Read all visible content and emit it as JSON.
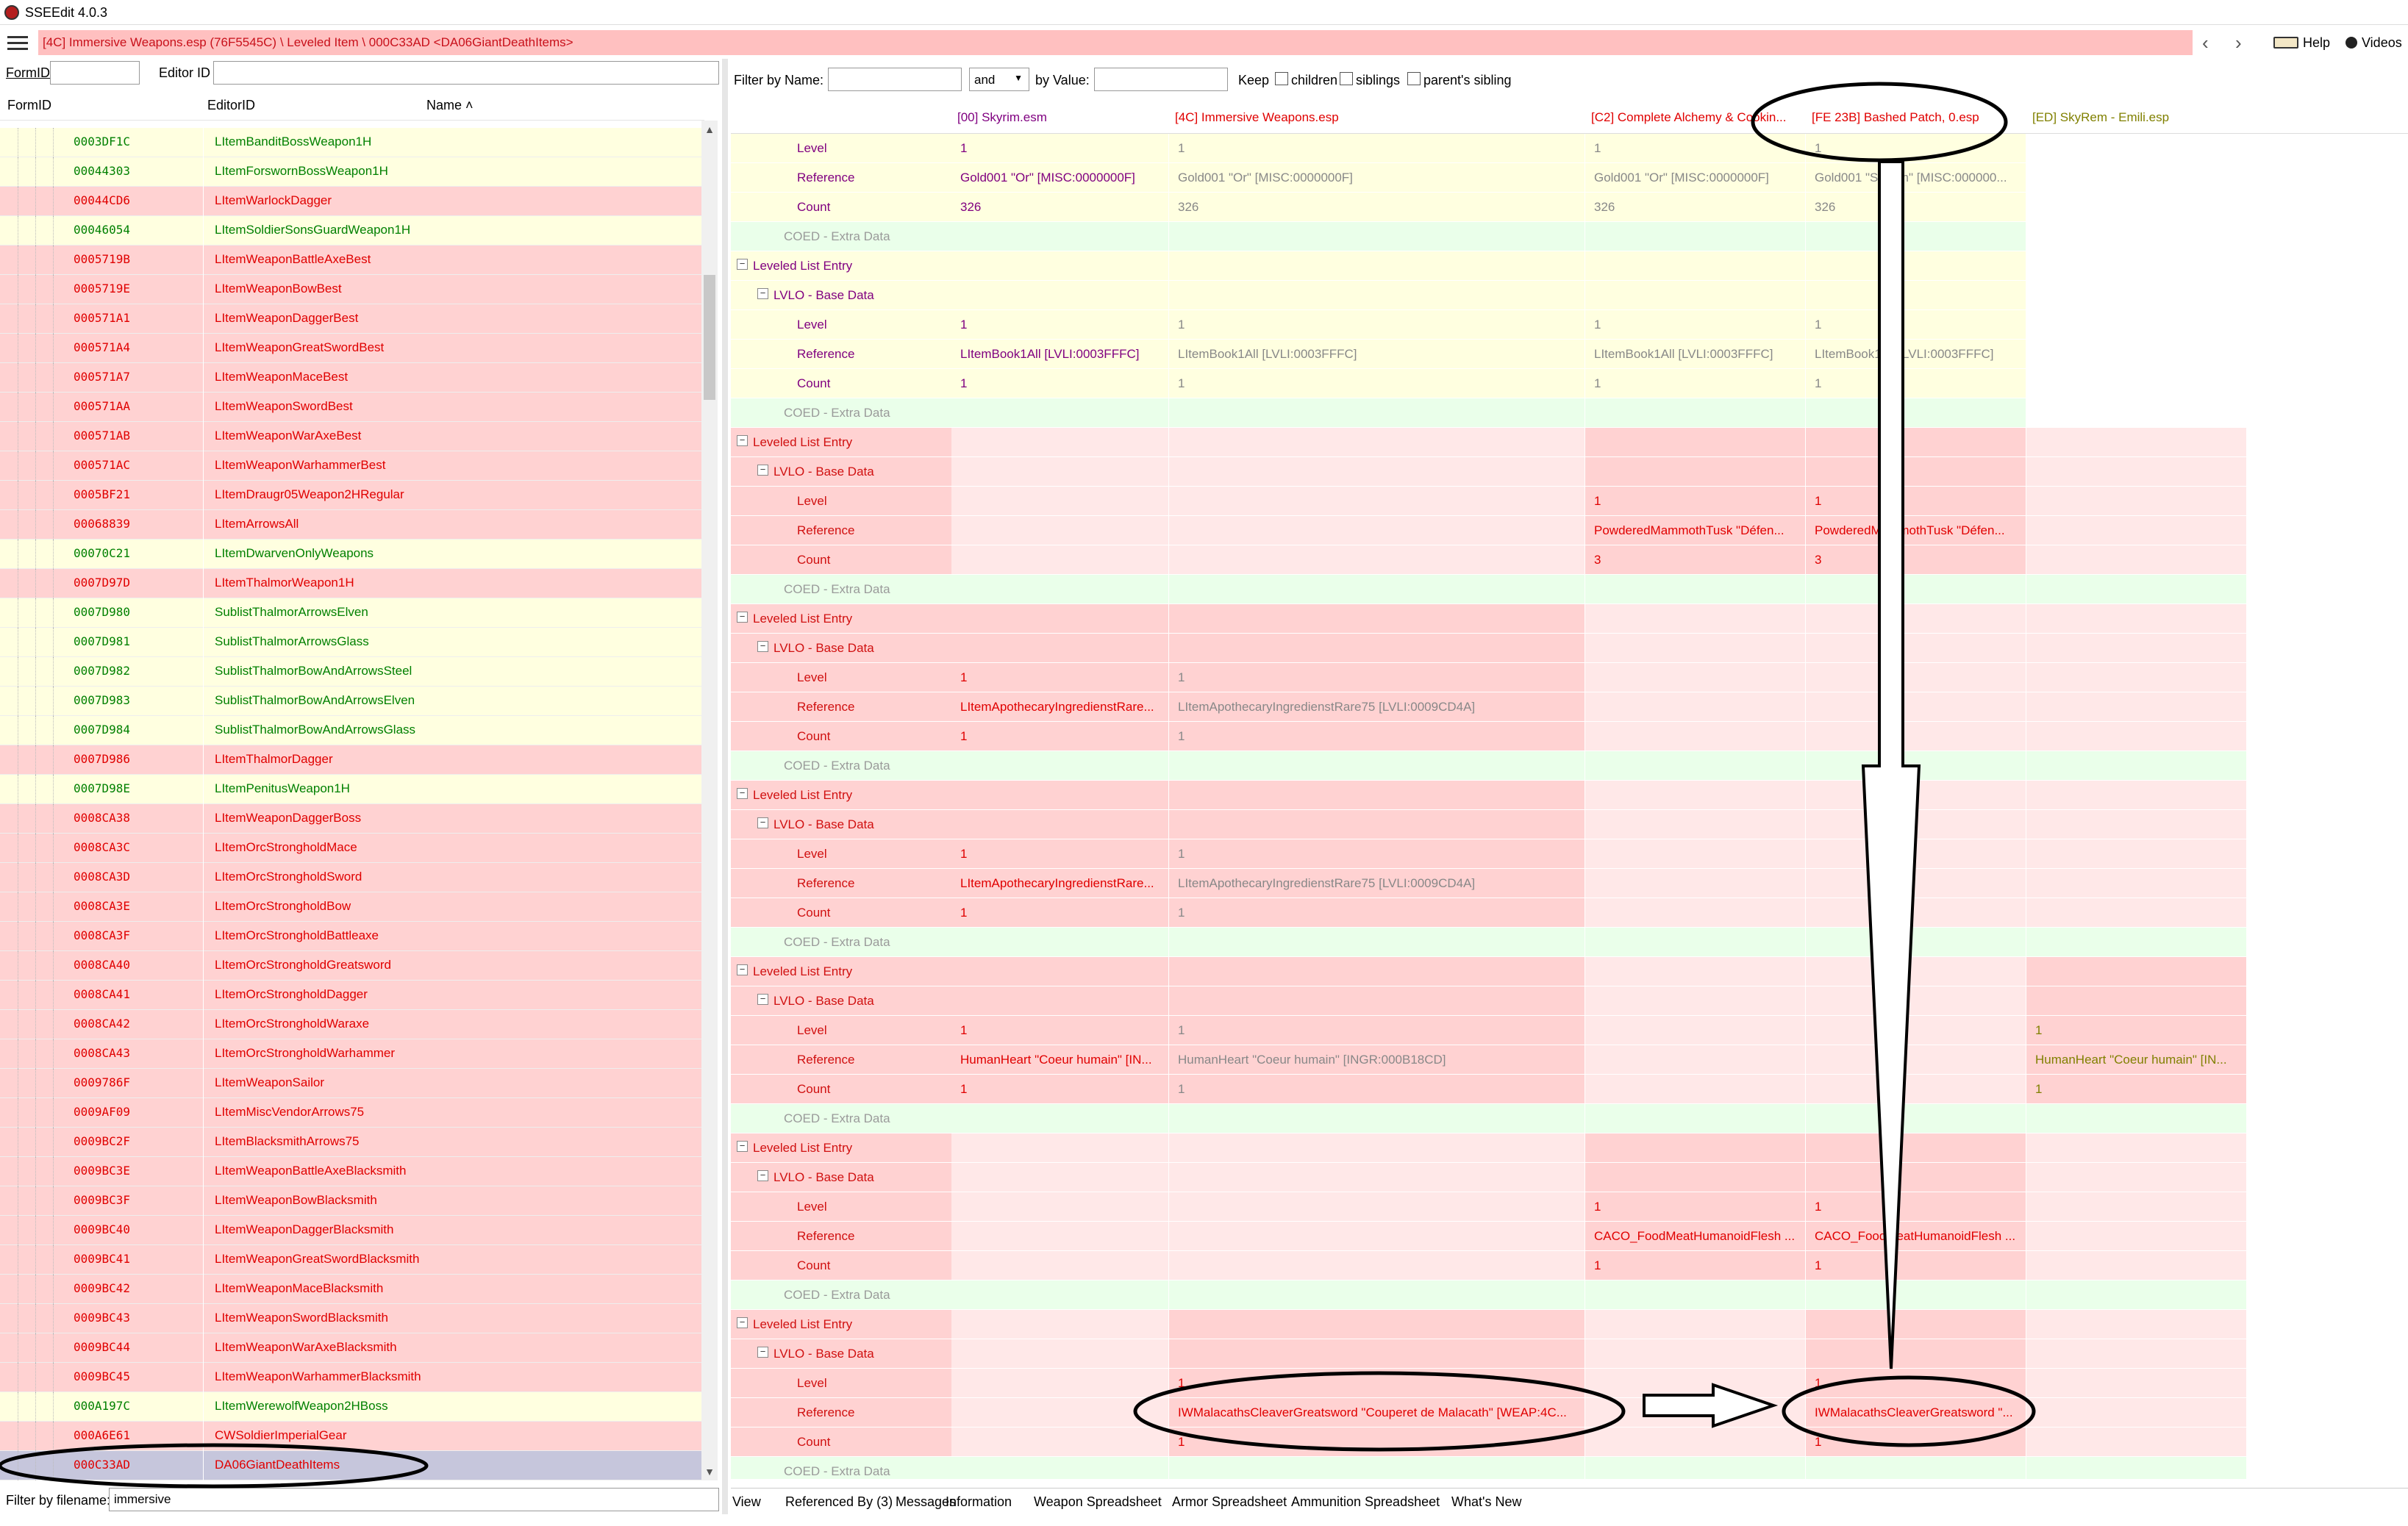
{
  "app": {
    "title": "SSEEdit 4.0.3"
  },
  "path": "[4C] Immersive Weapons.esp (76F5545C) \\ Leveled Item \\ 000C33AD <DA06GiantDeathItems>",
  "nav": {
    "back": "‹",
    "forward": "›",
    "help": "Help",
    "videos": "Videos"
  },
  "left_filter": {
    "formid_label": "FormID",
    "editorid_label": "Editor ID",
    "formid_value": "",
    "editorid_value": ""
  },
  "left_columns": {
    "formid": "FormID",
    "editorid": "EditorID",
    "name": "Name ˄"
  },
  "left_rows": [
    {
      "formid": "0003DF1C",
      "editorid": "LItemBanditBossWeapon1H",
      "status": "ok"
    },
    {
      "formid": "00044303",
      "editorid": "LItemForswornBossWeapon1H",
      "status": "ok"
    },
    {
      "formid": "00044CD6",
      "editorid": "LItemWarlockDagger",
      "status": "conflict"
    },
    {
      "formid": "00046054",
      "editorid": "LItemSoldierSonsGuardWeapon1H",
      "status": "ok"
    },
    {
      "formid": "0005719B",
      "editorid": "LItemWeaponBattleAxeBest",
      "status": "conflict"
    },
    {
      "formid": "0005719E",
      "editorid": "LItemWeaponBowBest",
      "status": "conflict"
    },
    {
      "formid": "000571A1",
      "editorid": "LItemWeaponDaggerBest",
      "status": "conflict"
    },
    {
      "formid": "000571A4",
      "editorid": "LItemWeaponGreatSwordBest",
      "status": "conflict"
    },
    {
      "formid": "000571A7",
      "editorid": "LItemWeaponMaceBest",
      "status": "conflict"
    },
    {
      "formid": "000571AA",
      "editorid": "LItemWeaponSwordBest",
      "status": "conflict"
    },
    {
      "formid": "000571AB",
      "editorid": "LItemWeaponWarAxeBest",
      "status": "conflict"
    },
    {
      "formid": "000571AC",
      "editorid": "LItemWeaponWarhammerBest",
      "status": "conflict"
    },
    {
      "formid": "0005BF21",
      "editorid": "LItemDraugr05Weapon2HRegular",
      "status": "conflict"
    },
    {
      "formid": "00068839",
      "editorid": "LItemArrowsAll",
      "status": "conflict"
    },
    {
      "formid": "00070C21",
      "editorid": "LItemDwarvenOnlyWeapons",
      "status": "ok"
    },
    {
      "formid": "0007D97D",
      "editorid": "LItemThalmorWeapon1H",
      "status": "conflict"
    },
    {
      "formid": "0007D980",
      "editorid": "SublistThalmorArrowsElven",
      "status": "ok"
    },
    {
      "formid": "0007D981",
      "editorid": "SublistThalmorArrowsGlass",
      "status": "ok"
    },
    {
      "formid": "0007D982",
      "editorid": "SublistThalmorBowAndArrowsSteel",
      "status": "ok"
    },
    {
      "formid": "0007D983",
      "editorid": "SublistThalmorBowAndArrowsElven",
      "status": "ok"
    },
    {
      "formid": "0007D984",
      "editorid": "SublistThalmorBowAndArrowsGlass",
      "status": "ok"
    },
    {
      "formid": "0007D986",
      "editorid": "LItemThalmorDagger",
      "status": "conflict"
    },
    {
      "formid": "0007D98E",
      "editorid": "LItemPenitusWeapon1H",
      "status": "ok"
    },
    {
      "formid": "0008CA38",
      "editorid": "LItemWeaponDaggerBoss",
      "status": "conflict"
    },
    {
      "formid": "0008CA3C",
      "editorid": "LItemOrcStrongholdMace",
      "status": "conflict"
    },
    {
      "formid": "0008CA3D",
      "editorid": "LItemOrcStrongholdSword",
      "status": "conflict"
    },
    {
      "formid": "0008CA3E",
      "editorid": "LItemOrcStrongholdBow",
      "status": "conflict"
    },
    {
      "formid": "0008CA3F",
      "editorid": "LItemOrcStrongholdBattleaxe",
      "status": "conflict"
    },
    {
      "formid": "0008CA40",
      "editorid": "LItemOrcStrongholdGreatsword",
      "status": "conflict"
    },
    {
      "formid": "0008CA41",
      "editorid": "LItemOrcStrongholdDagger",
      "status": "conflict"
    },
    {
      "formid": "0008CA42",
      "editorid": "LItemOrcStrongholdWaraxe",
      "status": "conflict"
    },
    {
      "formid": "0008CA43",
      "editorid": "LItemOrcStrongholdWarhammer",
      "status": "conflict"
    },
    {
      "formid": "0009786F",
      "editorid": "LItemWeaponSailor",
      "status": "conflict"
    },
    {
      "formid": "0009AF09",
      "editorid": "LItemMiscVendorArrows75",
      "status": "conflict"
    },
    {
      "formid": "0009BC2F",
      "editorid": "LItemBlacksmithArrows75",
      "status": "conflict"
    },
    {
      "formid": "0009BC3E",
      "editorid": "LItemWeaponBattleAxeBlacksmith",
      "status": "conflict"
    },
    {
      "formid": "0009BC3F",
      "editorid": "LItemWeaponBowBlacksmith",
      "status": "conflict"
    },
    {
      "formid": "0009BC40",
      "editorid": "LItemWeaponDaggerBlacksmith",
      "status": "conflict"
    },
    {
      "formid": "0009BC41",
      "editorid": "LItemWeaponGreatSwordBlacksmith",
      "status": "conflict"
    },
    {
      "formid": "0009BC42",
      "editorid": "LItemWeaponMaceBlacksmith",
      "status": "conflict"
    },
    {
      "formid": "0009BC43",
      "editorid": "LItemWeaponSwordBlacksmith",
      "status": "conflict"
    },
    {
      "formid": "0009BC44",
      "editorid": "LItemWeaponWarAxeBlacksmith",
      "status": "conflict"
    },
    {
      "formid": "0009BC45",
      "editorid": "LItemWeaponWarhammerBlacksmith",
      "status": "conflict"
    },
    {
      "formid": "000A197C",
      "editorid": "LItemWerewolfWeapon2HBoss",
      "status": "ok"
    },
    {
      "formid": "000A6E61",
      "editorid": "CWSoldierImperialGear",
      "status": "conflict"
    },
    {
      "formid": "000C33AD",
      "editorid": "DA06GiantDeathItems",
      "status": "selected"
    }
  ],
  "left_bottom": {
    "label": "Filter by filename:",
    "value": "immersive"
  },
  "right_filter": {
    "by_name": "Filter by Name:",
    "and_value": "and",
    "by_value": "by Value:",
    "keep": "Keep",
    "children": "children",
    "siblings": "siblings",
    "parents_sibling": "parent's sibling"
  },
  "plugins": [
    "[00] Skyrim.esm",
    "[4C] Immersive Weapons.esp",
    "[C2] Complete Alchemy & Cookin...",
    "[FE 23B] Bashed Patch, 0.esp",
    "[ED] SkyRem - Emili.esp"
  ],
  "tree_labels": {
    "lle": "Leveled List Entry",
    "lvlo": "LVLO - Base Data",
    "level": "Level",
    "reference": "Reference",
    "count": "Count",
    "coed": "COED - Extra Data"
  },
  "record_rows": [
    {
      "type": "level",
      "values": [
        "1",
        "1",
        "1",
        "1",
        ""
      ]
    },
    {
      "type": "reference",
      "values": [
        "Gold001 \"Or\" [MISC:0000000F]",
        "Gold001 \"Or\" [MISC:0000000F]",
        "Gold001 \"Or\" [MISC:0000000F]",
        "Gold001 \"Septim\" [MISC:000000...",
        ""
      ]
    },
    {
      "type": "count",
      "values": [
        "326",
        "326",
        "326",
        "326",
        ""
      ]
    },
    {
      "type": "coed"
    },
    {
      "type": "lle"
    },
    {
      "type": "lvlo"
    },
    {
      "type": "level",
      "values": [
        "1",
        "1",
        "1",
        "1",
        ""
      ]
    },
    {
      "type": "reference",
      "values": [
        "LItemBook1All [LVLI:0003FFFC]",
        "LItemBook1All [LVLI:0003FFFC]",
        "LItemBook1All [LVLI:0003FFFC]",
        "LItemBook1All [LVLI:0003FFFC]",
        ""
      ]
    },
    {
      "type": "count",
      "values": [
        "1",
        "1",
        "1",
        "1",
        ""
      ]
    },
    {
      "type": "coed"
    },
    {
      "type": "lle"
    },
    {
      "type": "lvlo"
    },
    {
      "type": "level",
      "values": [
        "",
        "",
        "1",
        "1",
        ""
      ]
    },
    {
      "type": "reference",
      "values": [
        "",
        "",
        "PowderedMammothTusk \"Défen...",
        "PowderedMammothTusk \"Défen...",
        ""
      ]
    },
    {
      "type": "count",
      "values": [
        "",
        "",
        "3",
        "3",
        ""
      ]
    },
    {
      "type": "coed"
    },
    {
      "type": "lle"
    },
    {
      "type": "lvlo"
    },
    {
      "type": "level",
      "values": [
        "1",
        "1",
        "",
        "",
        ""
      ]
    },
    {
      "type": "reference",
      "values": [
        "LItemApothecaryIngredienstRare...",
        "LItemApothecaryIngredienstRare75 [LVLI:0009CD4A]",
        "",
        "",
        ""
      ]
    },
    {
      "type": "count",
      "values": [
        "1",
        "1",
        "",
        "",
        ""
      ]
    },
    {
      "type": "coed"
    },
    {
      "type": "lle"
    },
    {
      "type": "lvlo"
    },
    {
      "type": "level",
      "values": [
        "1",
        "1",
        "",
        "",
        ""
      ]
    },
    {
      "type": "reference",
      "values": [
        "LItemApothecaryIngredienstRare...",
        "LItemApothecaryIngredienstRare75 [LVLI:0009CD4A]",
        "",
        "",
        ""
      ]
    },
    {
      "type": "count",
      "values": [
        "1",
        "1",
        "",
        "",
        ""
      ]
    },
    {
      "type": "coed"
    },
    {
      "type": "lle"
    },
    {
      "type": "lvlo"
    },
    {
      "type": "level",
      "values": [
        "1",
        "1",
        "",
        "",
        "1"
      ]
    },
    {
      "type": "reference",
      "values": [
        "HumanHeart \"Coeur humain\" [IN...",
        "HumanHeart \"Coeur humain\" [INGR:000B18CD]",
        "",
        "",
        "HumanHeart \"Coeur humain\" [IN..."
      ]
    },
    {
      "type": "count",
      "values": [
        "1",
        "1",
        "",
        "",
        "1"
      ]
    },
    {
      "type": "coed"
    },
    {
      "type": "lle"
    },
    {
      "type": "lvlo"
    },
    {
      "type": "level",
      "values": [
        "",
        "",
        "1",
        "1",
        ""
      ]
    },
    {
      "type": "reference",
      "values": [
        "",
        "",
        "CACO_FoodMeatHumanoidFlesh ...",
        "CACO_FoodMeatHumanoidFlesh ...",
        ""
      ]
    },
    {
      "type": "count",
      "values": [
        "",
        "",
        "1",
        "1",
        ""
      ]
    },
    {
      "type": "coed"
    },
    {
      "type": "lle"
    },
    {
      "type": "lvlo"
    },
    {
      "type": "level",
      "values": [
        "",
        "1",
        "",
        "1",
        ""
      ]
    },
    {
      "type": "reference",
      "values": [
        "",
        "IWMalacathsCleaverGreatsword \"Couperet de Malacath\" [WEAP:4C...",
        "",
        "IWMalacathsCleaverGreatsword \"...",
        ""
      ]
    },
    {
      "type": "count",
      "values": [
        "",
        "1",
        "",
        "1",
        ""
      ]
    },
    {
      "type": "coed"
    }
  ],
  "bottom_tabs": [
    "View",
    "Referenced By (3)",
    "Messages",
    "Information",
    "Weapon Spreadsheet",
    "Armor Spreadsheet",
    "Ammunition Spreadsheet",
    "What's New"
  ],
  "colors": {
    "ok_bg": "#ffffe0",
    "conflict_bg": "#ffd2d2",
    "ok_text": "#008000",
    "conflict_text": "#e00000",
    "selected_bg": "#c6c6dc",
    "coed_bg": "#eaffea"
  }
}
